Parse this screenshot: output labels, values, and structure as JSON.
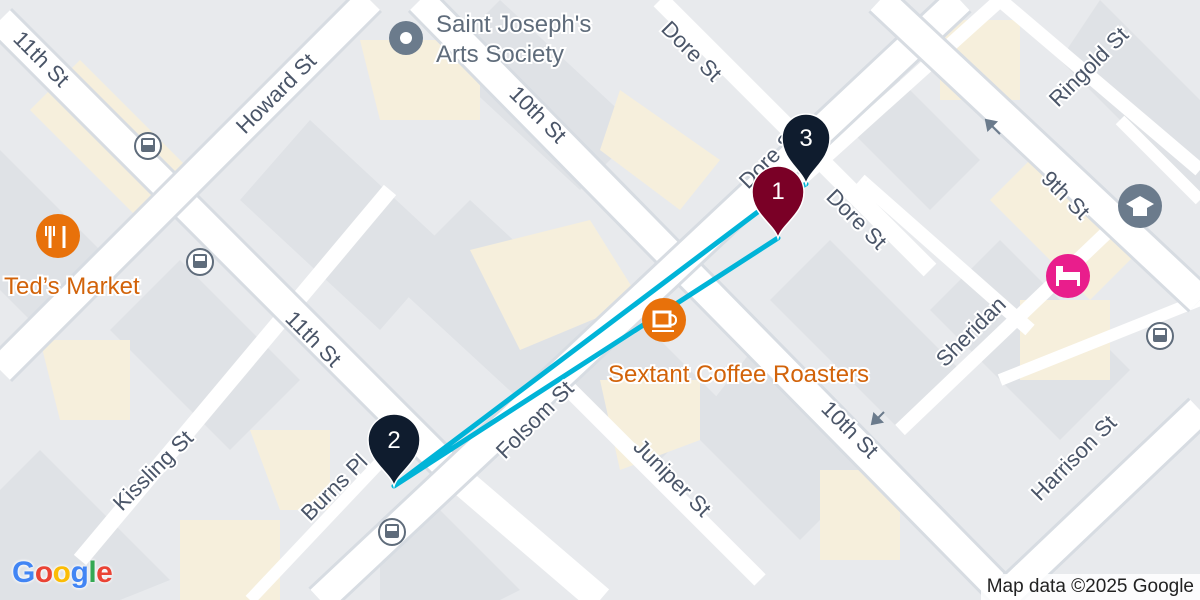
{
  "map": {
    "streets": {
      "eleventh_upper": "11th St",
      "howard": "Howard St",
      "tenth_upper": "10th St",
      "dore_upper": "Dore St",
      "ringold": "Ringold St",
      "dore_middle": "Dore St",
      "dore_lower": "Dore St",
      "ninth": "9th St",
      "eleventh_lower": "11th St",
      "sheridan": "Sheridan",
      "folsom": "Folsom St",
      "tenth_lower": "10th St",
      "harrison": "Harrison St",
      "kissling": "Kissling St",
      "burns": "Burns Pl",
      "juniper": "Juniper St"
    },
    "pois": {
      "arts_society_line1": "Saint Joseph's",
      "arts_society_line2": "Arts Society",
      "teds_market": "Ted’s Market",
      "sextant": "Sextant Coffee Roasters"
    },
    "markers": [
      "1",
      "2",
      "3"
    ],
    "icons": {
      "place": "place-icon",
      "restaurant": "restaurant-icon",
      "cafe": "cafe-icon",
      "school": "school-icon",
      "hotel": "hotel-icon",
      "bus": "bus-icon",
      "one_way_arrow": "arrow-icon"
    },
    "colors": {
      "route": "#00b4d8",
      "marker_1": "#7a0026",
      "marker_other": "#0f1c2e",
      "poi_orange": "#e8710a",
      "poi_gray": "#6b7b8c",
      "hotel": "#e91e8c"
    }
  },
  "attribution": "Map data ©2025 Google",
  "logo": {
    "g1": "G",
    "o1": "o",
    "o2": "o",
    "g2": "g",
    "l": "l",
    "e": "e"
  }
}
